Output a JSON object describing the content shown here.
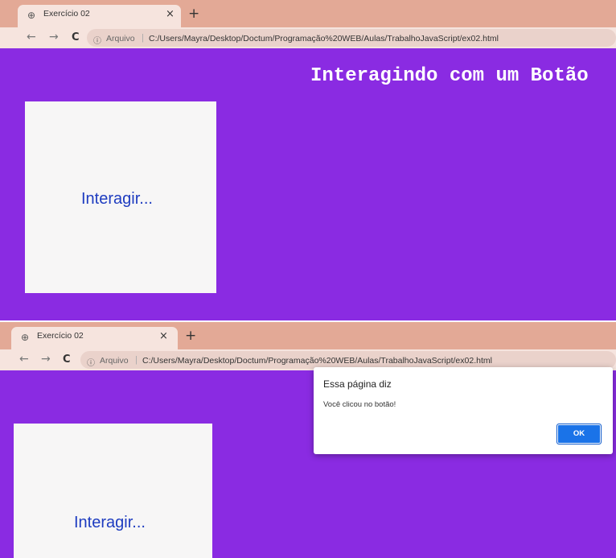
{
  "screenshot1": {
    "tab": {
      "title": "Exercício 02",
      "close": "×"
    },
    "new_tab": "+",
    "nav": {
      "back": "←",
      "forward": "→",
      "reload": "C"
    },
    "address": {
      "scheme_label": "Arquivo",
      "url": "C:/Users/Mayra/Desktop/Doctum/Programação%20WEB/Aulas/TrabalhoJavaScript/ex02.html"
    },
    "page": {
      "heading": "Interagindo com um Botão",
      "button_label": "Interagir..."
    }
  },
  "screenshot2": {
    "tab": {
      "title": "Exercício 02",
      "close": "×"
    },
    "new_tab": "+",
    "nav": {
      "back": "←",
      "forward": "→",
      "reload": "C"
    },
    "address": {
      "scheme_label": "Arquivo",
      "url": "C:/Users/Mayra/Desktop/Doctum/Programação%20WEB/Aulas/TrabalhoJavaScript/ex02.html"
    },
    "page": {
      "button_label": "Interagir..."
    },
    "alert": {
      "title": "Essa página diz",
      "message": "Você clicou no botão!",
      "ok": "OK"
    }
  },
  "colors": {
    "page_bg": "#8a2be2",
    "tab_strip": "#e3a996",
    "button_text": "#1e3cc0",
    "ok_button": "#1a73e8"
  }
}
